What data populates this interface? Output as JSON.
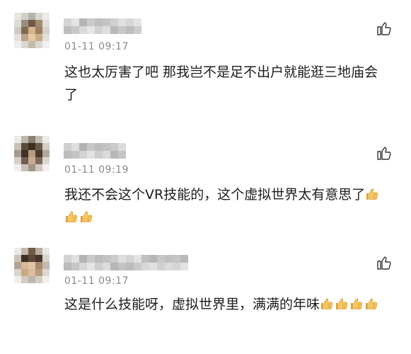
{
  "comments": [
    {
      "time": "01-11 09:17",
      "text": "这也太厉害了吧 那我岂不是足不出户就能逛三地庙会了",
      "emoji_count": 0,
      "avatar_colors": [
        "#e6e6e2",
        "#cfcfcb",
        "#b7b3aa",
        "#d8d6d1",
        "#ebebe8",
        "#dcdcd8",
        "#9c8f7d",
        "#6e5a45",
        "#a08c73",
        "#e1dfdb",
        "#cfccc6",
        "#7f6b52",
        "#d6b48c",
        "#9b8061",
        "#d4d1cb",
        "#e2e1dd",
        "#b9a48a",
        "#e7c9a2",
        "#c9ac85",
        "#e0dfdb",
        "#efefec",
        "#d9d7d2",
        "#c6bba9",
        "#dad8d3",
        "#f0f0ee"
      ],
      "name_colors": [
        "#d4d4d4",
        "#bdbdbd",
        "#e3e3e3",
        "#c8c8c8",
        "#b5b5b5",
        "#d9d9d9",
        "#cacaca",
        "#e6e6e6",
        "#bfbfbf",
        "#d1d1d1",
        "#c4c4c4",
        "#dedede",
        "#cfcfcf",
        "#b9b9b9",
        "#e0e0e0",
        "#c7c7c7",
        "#d6d6d6",
        "#bcbcbc",
        "#e4e4e4",
        "#cccccc"
      ]
    },
    {
      "time": "01-11 09:19",
      "text": "我还不会这个VR技能的，这个虚拟世界太有意思了",
      "emoji_count": 3,
      "avatar_colors": [
        "#e9e9e7",
        "#bdb6ad",
        "#8d7f70",
        "#c4bcb2",
        "#ebebe9",
        "#c9c2b8",
        "#5a4a3c",
        "#3b2e24",
        "#6b5848",
        "#d2ccc4",
        "#a79b8d",
        "#3f3128",
        "#b89a80",
        "#4a3a2e",
        "#b2a798",
        "#d6d0c8",
        "#6f5e50",
        "#c8ab90",
        "#7d6a59",
        "#dcd7d0",
        "#efeeec",
        "#c9c1b6",
        "#a2968a",
        "#cfc8be",
        "#f1f0ee"
      ],
      "name_colors": [
        "#cfcfcf",
        "#bcbcbc",
        "#dedede",
        "#c4c4c4",
        "#b3b3b3",
        "#d3d3d3",
        "#c8c8c8",
        "#e2e2e2",
        "#bebebe",
        "#cccccc",
        "#c1c1c1",
        "#dadada",
        "#c9c9c9",
        "#b8b8b8",
        "#dcdcdc",
        "#c5c5c5"
      ]
    },
    {
      "time": "01-11 09:17",
      "text": "这是什么技能呀，虚拟世界里，满满的年味",
      "emoji_count": 4,
      "avatar_colors": [
        "#ecebe9",
        "#c2b7ab",
        "#6e5b4a",
        "#b9ad9f",
        "#e9e8e6",
        "#cdc3b8",
        "#3e2f24",
        "#5c4838",
        "#463729",
        "#d8d2ca",
        "#b2a494",
        "#d7b897",
        "#e3c4a2",
        "#a68b6f",
        "#c4b9ac",
        "#d9d4cd",
        "#c8a986",
        "#dcbd9b",
        "#b99b7d",
        "#dcd8d2",
        "#eeeeec",
        "#d1cbc3",
        "#bfb4a8",
        "#d4cec6",
        "#f0efee"
      ],
      "name_colors": [
        "#d2d2d2",
        "#bababa",
        "#e1e1e1",
        "#c6c6c6",
        "#b4b4b4",
        "#d7d7d7",
        "#c9c9c9",
        "#e5e5e5",
        "#bdbdbd",
        "#cfcfcf",
        "#c2c2c2",
        "#dcdcdc",
        "#cbcbcb",
        "#b7b7b7",
        "#dfdfdf",
        "#c3c3c3",
        "#d5d5d5",
        "#bbbbbb",
        "#e3e3e3",
        "#cacaca",
        "#c0c0c0",
        "#d8d8d8",
        "#b6b6b6",
        "#e0e0e0",
        "#c7c7c7",
        "#d0d0d0",
        "#bfbfbf",
        "#dbdbdb",
        "#c5c5c5",
        "#d4d4d4",
        "#b9b9b9",
        "#e2e2e2"
      ]
    }
  ]
}
